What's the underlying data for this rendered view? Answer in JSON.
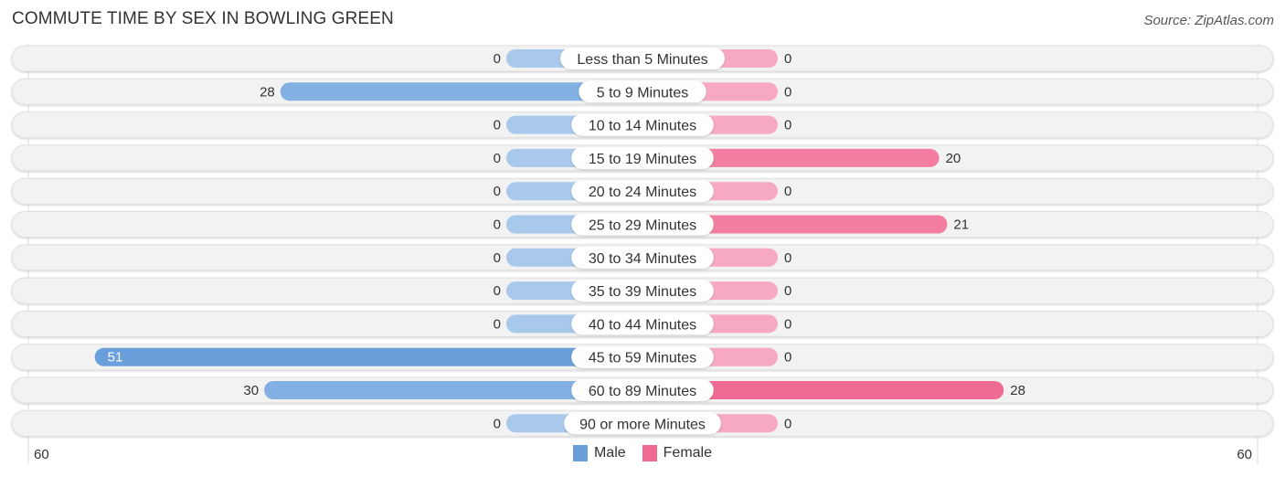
{
  "header": {
    "title": "COMMUTE TIME BY SEX IN BOWLING GREEN",
    "source": "Source: ZipAtlas.com"
  },
  "colors": {
    "male": "#6a9fdc",
    "male_light": "#a8c8ec",
    "female": "#f06b93",
    "female_light": "#f7a8c2",
    "row_bg": "#f2f2f2"
  },
  "chart_data": {
    "type": "bar",
    "orientation": "horizontal-diverging",
    "title": "COMMUTE TIME BY SEX IN BOWLING GREEN",
    "categories": [
      "Less than 5 Minutes",
      "5 to 9 Minutes",
      "10 to 14 Minutes",
      "15 to 19 Minutes",
      "20 to 24 Minutes",
      "25 to 29 Minutes",
      "30 to 34 Minutes",
      "35 to 39 Minutes",
      "40 to 44 Minutes",
      "45 to 59 Minutes",
      "60 to 89 Minutes",
      "90 or more Minutes"
    ],
    "series": [
      {
        "name": "Male",
        "values": [
          0,
          28,
          0,
          0,
          0,
          0,
          0,
          0,
          0,
          51,
          30,
          0
        ]
      },
      {
        "name": "Female",
        "values": [
          0,
          0,
          0,
          20,
          0,
          21,
          0,
          0,
          0,
          0,
          28,
          0
        ]
      }
    ],
    "xlim": [
      60,
      60
    ],
    "axis_labels": {
      "left": "60",
      "right": "60"
    },
    "legend": {
      "position": "bottom-center",
      "entries": [
        "Male",
        "Female"
      ]
    }
  }
}
